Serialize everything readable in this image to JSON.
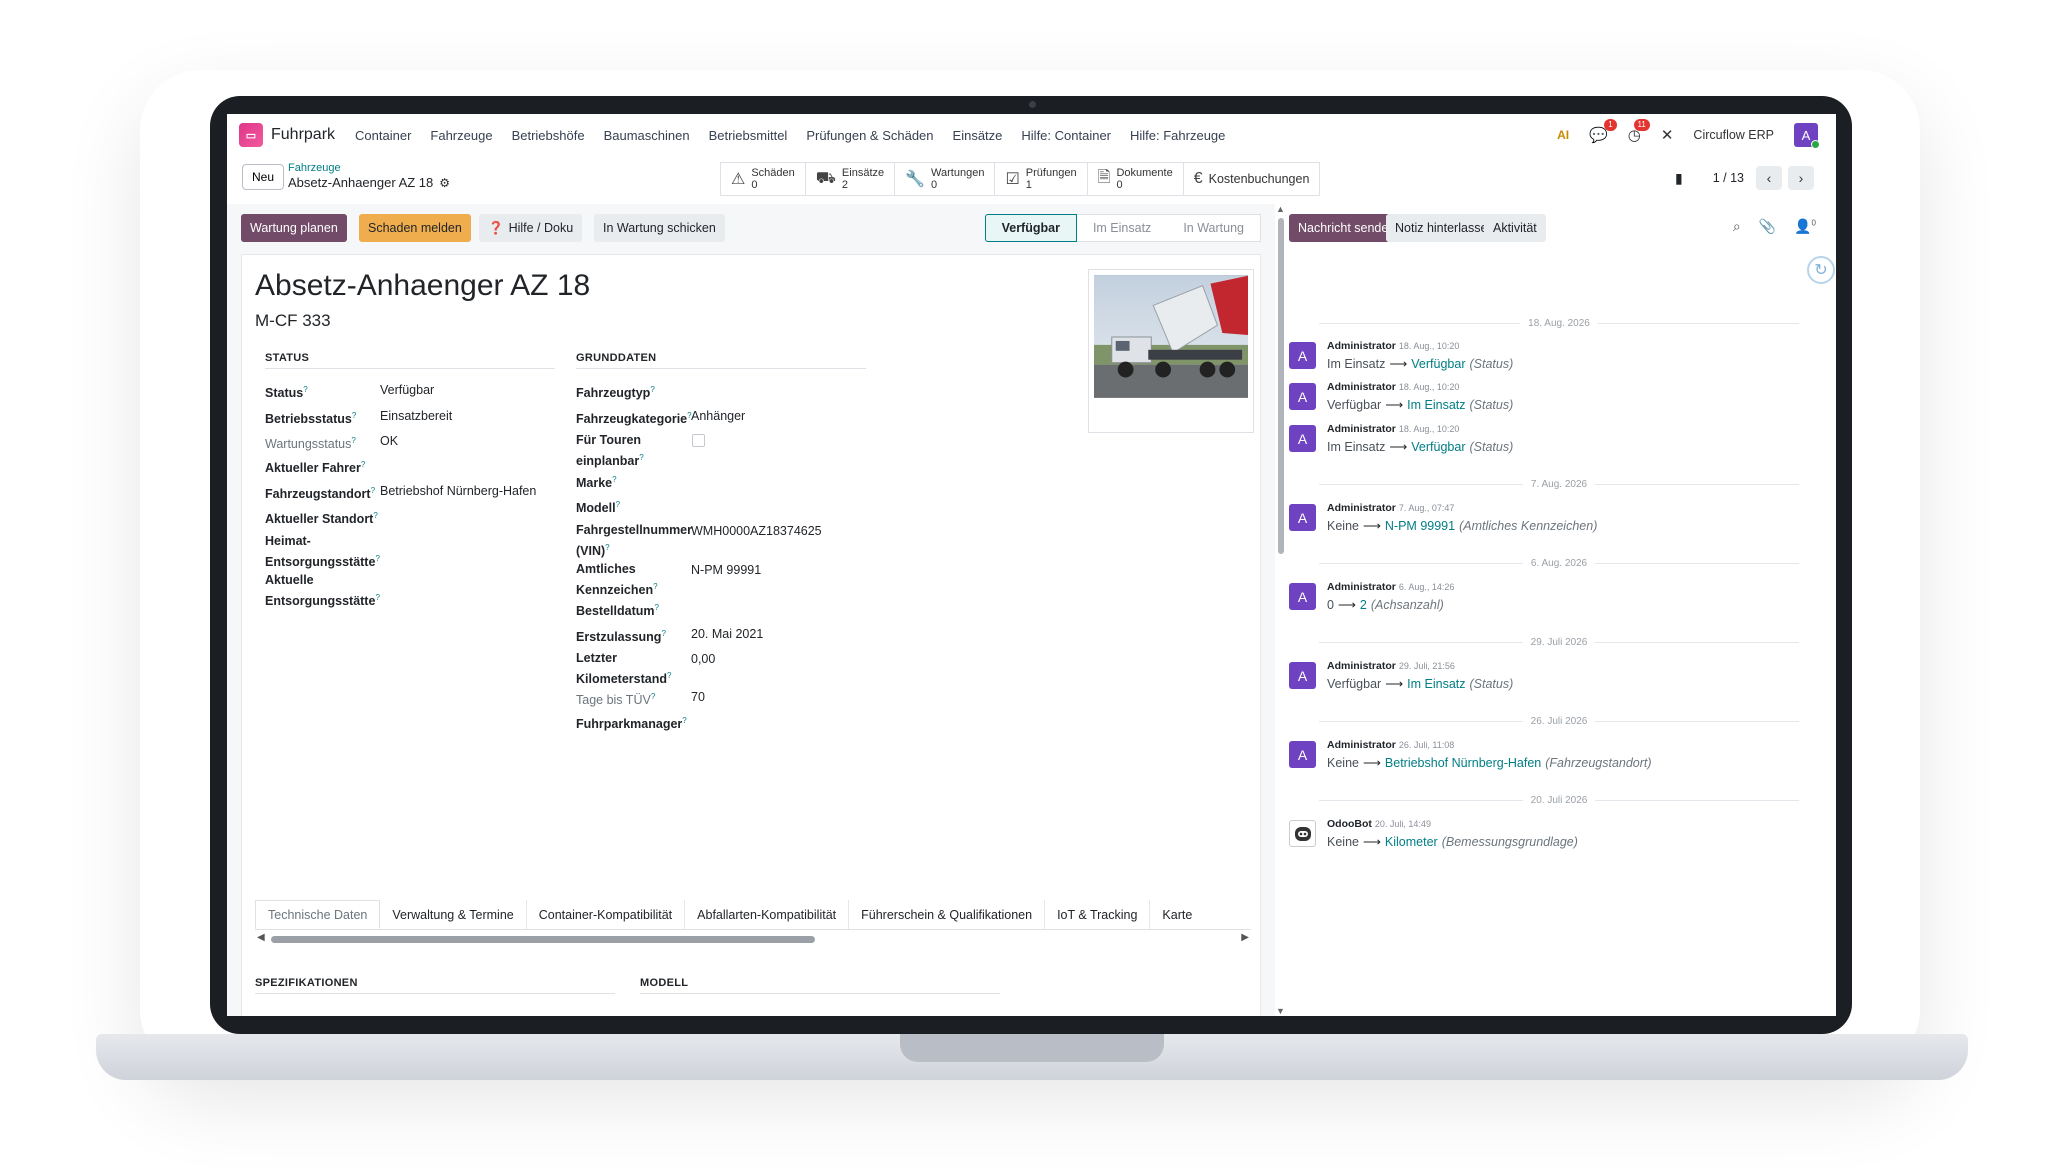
{
  "navbar": {
    "logo_text": "▭",
    "app_name": "Fuhrpark",
    "menu": [
      "Container",
      "Fahrzeuge",
      "Betriebshöfe",
      "Baumaschinen",
      "Betriebsmittel",
      "Prüfungen & Schäden",
      "Einsätze",
      "Hilfe: Container",
      "Hilfe: Fahrzeuge"
    ],
    "ai_label": "AI",
    "messages_badge": "1",
    "activities_badge": "11",
    "company": "Circuflow ERP",
    "user_initial": "A"
  },
  "control": {
    "new_label": "Neu",
    "breadcrumb_parent": "Fahrzeuge",
    "breadcrumb_current": "Absetz-Anhaenger AZ 18",
    "smart_buttons": [
      {
        "label": "Schäden",
        "count": "0",
        "icon": "warning-icon"
      },
      {
        "label": "Einsätze",
        "count": "2",
        "icon": "truck-icon"
      },
      {
        "label": "Wartungen",
        "count": "0",
        "icon": "wrench-icon"
      },
      {
        "label": "Prüfungen",
        "count": "1",
        "icon": "check-icon"
      },
      {
        "label": "Dokumente",
        "count": "0",
        "icon": "document-icon"
      }
    ],
    "cost_label": "Kostenbuchungen",
    "pager": "1 / 13"
  },
  "statusbar": {
    "buttons": [
      "Wartung planen",
      "Schaden melden",
      "Hilfe / Doku",
      "In Wartung schicken"
    ],
    "stages": [
      "Verfügbar",
      "Im Einsatz",
      "In Wartung"
    ],
    "active_stage": "Verfügbar"
  },
  "record": {
    "title": "Absetz-Anhaenger AZ 18",
    "plate": "M-CF 333"
  },
  "groups": {
    "status": {
      "title": "STATUS",
      "fields": [
        {
          "label": "Status",
          "value": "Verfügbar"
        },
        {
          "label": "Betriebsstatus",
          "value": "Einsatzbereit"
        },
        {
          "label": "Wartungsstatus",
          "value": "OK"
        },
        {
          "label": "Aktueller Fahrer",
          "value": ""
        },
        {
          "label": "Fahrzeugstandort",
          "value": "Betriebshof Nürnberg-Hafen"
        },
        {
          "label": "Aktueller Standort",
          "value": ""
        },
        {
          "label": "Heimat-",
          "label2": "Entsorgungsstätte",
          "value": ""
        },
        {
          "label": "Aktuelle",
          "label2": "Entsorgungsstätte",
          "value": ""
        }
      ]
    },
    "grunddaten": {
      "title": "GRUNDDATEN",
      "fields": [
        {
          "label": "Fahrzeugtyp",
          "value": ""
        },
        {
          "label": "Fahrzeugkategorie",
          "value": "Anhänger"
        },
        {
          "label": "Für Touren",
          "label2": "einplanbar",
          "value": ""
        },
        {
          "label": "Marke",
          "value": ""
        },
        {
          "label": "Modell",
          "value": ""
        },
        {
          "label": "Fahrgestellnummer",
          "label2": "(VIN)",
          "value": "WMH0000AZ18374625"
        },
        {
          "label": "Amtliches",
          "label2": "Kennzeichen",
          "value": "N-PM 99991"
        },
        {
          "label": "Bestelldatum",
          "value": ""
        },
        {
          "label": "Erstzulassung",
          "value": "20. Mai 2021"
        },
        {
          "label": "Letzter",
          "label2": "Kilometerstand",
          "value": "0,00"
        },
        {
          "label": "Tage bis TÜV",
          "value": "70"
        },
        {
          "label": "Fuhrparkmanager",
          "value": ""
        }
      ]
    }
  },
  "tabs": [
    "Technische Daten",
    "Verwaltung & Termine",
    "Container-Kompatibilität",
    "Abfallarten-Kompatibilität",
    "Führerschein & Qualifikationen",
    "IoT & Tracking",
    "Karte"
  ],
  "lower_groups": [
    "SPEZIFIKATIONEN",
    "MODELL"
  ],
  "chatter": {
    "buttons": [
      "Nachricht senden",
      "Notiz hinterlassen",
      "Aktivität"
    ],
    "follower_count": "0",
    "separators": [
      "18. Aug. 2026",
      "7. Aug. 2026",
      "6. Aug. 2026",
      "29. Juli 2026",
      "26. Juli 2026",
      "20. Juli 2026"
    ],
    "messages": [
      {
        "author": "Administrator",
        "date": "18. Aug., 10:20",
        "old": "Im Einsatz",
        "new": "Verfügbar",
        "field": "(Status)"
      },
      {
        "author": "Administrator",
        "date": "18. Aug., 10:20",
        "old": "Verfügbar",
        "new": "Im Einsatz",
        "field": "(Status)"
      },
      {
        "author": "Administrator",
        "date": "18. Aug., 10:20",
        "old": "Im Einsatz",
        "new": "Verfügbar",
        "field": "(Status)"
      },
      {
        "author": "Administrator",
        "date": "7. Aug., 07:47",
        "old": "Keine",
        "new": "N-PM 99991",
        "field": "(Amtliches Kennzeichen)"
      },
      {
        "author": "Administrator",
        "date": "6. Aug., 14:26",
        "old": "0",
        "new": "2",
        "field": "(Achsanzahl)"
      },
      {
        "author": "Administrator",
        "date": "29. Juli, 21:56",
        "old": "Verfügbar",
        "new": "Im Einsatz",
        "field": "(Status)"
      },
      {
        "author": "Administrator",
        "date": "26. Juli, 11:08",
        "old": "Keine",
        "new": "Betriebshof Nürnberg-Hafen",
        "field": "(Fahrzeugstandort)"
      },
      {
        "author": "OdooBot",
        "date": "20. Juli, 14:49",
        "old": "Keine",
        "new": "Kilometer",
        "field": "(Bemessungsgrundlage)"
      }
    ]
  },
  "colors": {
    "primary": "#714b67",
    "warning": "#f0ad4e",
    "link": "#017e84",
    "avatar": "#6f42c1"
  }
}
